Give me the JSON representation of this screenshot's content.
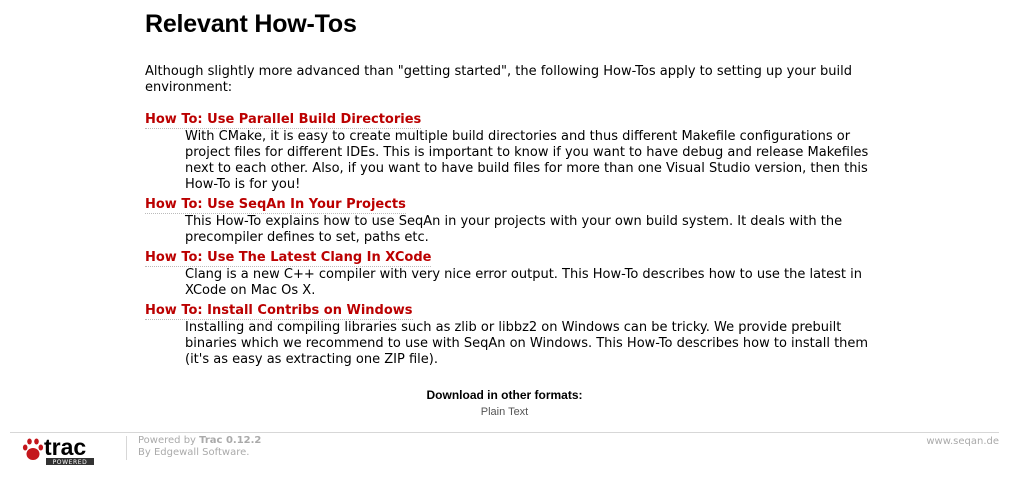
{
  "page": {
    "title": "Relevant How-Tos",
    "intro": "Although slightly more advanced than \"getting started\", the following How-Tos apply to setting up your build environment:"
  },
  "howtos": [
    {
      "title": "How To: Use Parallel Build Directories",
      "description": "With CMake, it is easy to create multiple build directories and thus different Makefile configurations or project files for different IDEs. This is important to know if you want to have debug and release Makefiles next to each other. Also, if you want to have build files for more than one Visual Studio version, then this How-To is for you!"
    },
    {
      "title": "How To: Use SeqAn In Your Projects",
      "description": "This How-To explains how to use SeqAn in your projects with your own build system. It deals with the precompiler defines to set, paths etc."
    },
    {
      "title": "How To: Use The Latest Clang In XCode",
      "description": "Clang is a new C++ compiler with very nice error output. This How-To describes how to use the latest in XCode on Mac Os X."
    },
    {
      "title": "How To: Install Contribs on Windows",
      "description": "Installing and compiling libraries such as zlib or libbz2 on Windows can be tricky. We provide prebuilt binaries which we recommend to use with SeqAn on Windows. This How-To describes how to install them (it's as easy as extracting one ZIP file)."
    }
  ],
  "downloads": {
    "heading": "Download in other formats:",
    "plain_text": "Plain Text"
  },
  "footer": {
    "logo_text": "trac",
    "logo_sub": "POWERED",
    "powered_by": "Powered by ",
    "trac_version": "Trac 0.12.2",
    "by_line": "By Edgewall Software.",
    "site": "www.seqan.de"
  },
  "colors": {
    "link": "#bb0000",
    "footer_text": "#aaaaaa",
    "logo_paw": "#c4161c"
  }
}
